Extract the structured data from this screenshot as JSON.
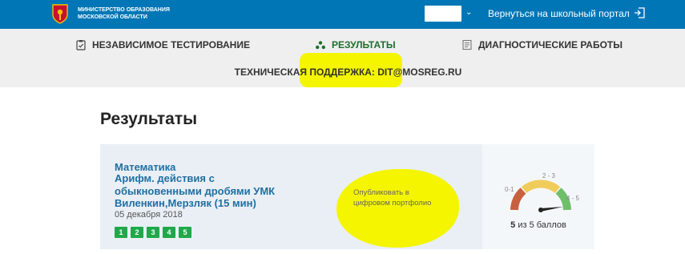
{
  "header": {
    "ministry_line1": "МИНИСТЕРСТВО ОБРАЗОВАНИЯ",
    "ministry_line2": "МОСКОВСКОЙ ОБЛАСТИ",
    "return_link": "Вернуться на школьный портал",
    "icons": {
      "logo": "coat-of-arms",
      "dropdown": "chevron-down-icon",
      "exit": "exit-icon"
    }
  },
  "nav": {
    "items": [
      {
        "label": "НЕЗАВИСИМОЕ ТЕСТИРОВАНИЕ",
        "icon": "clipboard-icon"
      },
      {
        "label": "РЕЗУЛЬТАТЫ",
        "icon": "results-icon",
        "active": true
      },
      {
        "label": "ДИАГНОСТИЧЕСКИЕ РАБОТЫ",
        "icon": "document-icon"
      }
    ],
    "support": "ТЕХНИЧЕСКАЯ ПОДДЕРЖКА: DIT@MOSREG.RU"
  },
  "main": {
    "title": "Результаты",
    "result": {
      "subject": "Математика",
      "title": "Арифм. действия с обыкновенными дробями УМК Виленкин,Мерзляк (15 мин)",
      "date": "05 декабря 2018",
      "badges": [
        "1",
        "2",
        "3",
        "4",
        "5"
      ],
      "publish": "Опубликовать в цифровом портфолио",
      "gauge_labels": [
        "0-1",
        "2 - 3",
        "4 - 5"
      ],
      "score_value": "5",
      "score_text": "из 5 баллов",
      "score_fraction": 1.0
    }
  },
  "colors": {
    "header_bg": "#0076b6",
    "nav_bg": "#efefef",
    "active_tab": "#1d6e2e",
    "link": "#1f6fa3",
    "badge": "#21a84a",
    "gauge_low": "#c8603f",
    "gauge_mid": "#f0cd5a",
    "gauge_high": "#6fbf6a",
    "highlight": "#f5f500"
  }
}
